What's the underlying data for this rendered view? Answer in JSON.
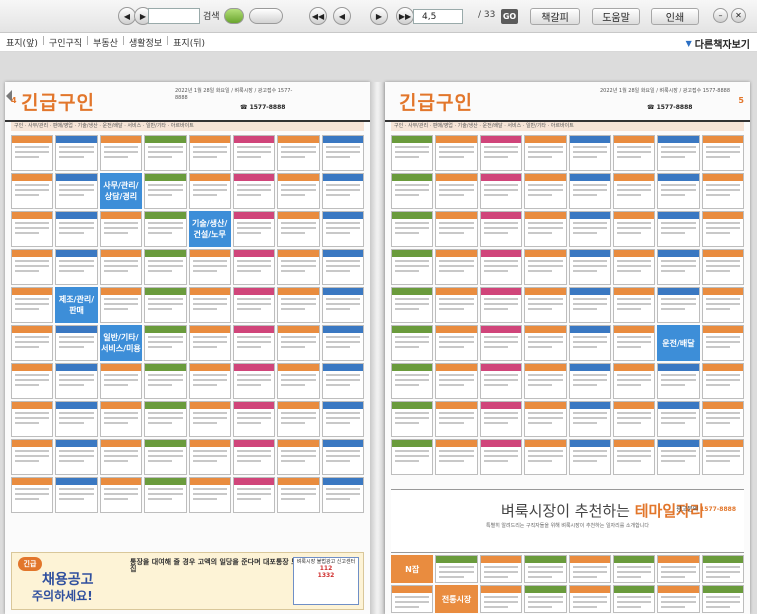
{
  "toolbar": {
    "search_label": "검색",
    "page_current": "4,5",
    "page_total": "/ 33",
    "go_label": "GO",
    "view_label": "책갈피",
    "help_label": "도움말",
    "print_label": "인쇄",
    "nav_first": "◀◀",
    "nav_prev": "◀",
    "nav_next": "▶",
    "nav_last": "▶▶"
  },
  "breadcrumb": {
    "items": [
      "표지(앞)",
      "구인구직",
      "부동산",
      "생활정보",
      "표지(뒤)"
    ]
  },
  "more_button": {
    "label": "다른책자보기"
  },
  "left_page": {
    "number": "4",
    "title": "긴급구인",
    "info": "2022년 1월 28일 화요일 / 벼룩시장 / 광고접수 1577-8888",
    "phone": "☎ 1577-8888",
    "category_bar": "구인 · 사무/관리 · 판매/영업 · 기술/생산 · 운전/배달 · 서비스 · 일반/기타 · 아르바이트",
    "feature_tiles": [
      "사무/관리/상담/경리",
      "기술/생산/건설/노무",
      "제조/관리/판매",
      "일반/기타/서비스/미용"
    ],
    "banner": {
      "badge": "긴급",
      "title": "채용공고",
      "subtitle": "주의하세요!",
      "headline": "통장을 대여해 줄 경우 고액의 일당을 준다며 대포통장 모집",
      "box_label": "벼룩시장 불법광고 신고센터",
      "box_number_1": "112",
      "box_number_2": "1332"
    }
  },
  "right_page": {
    "number": "5",
    "title": "긴급구인",
    "info": "2022년 1월 28일 화요일 / 벼룩시장 / 광고접수 1577-8888",
    "phone": "☎ 1577-8888",
    "category_bar": "구인 · 사무/관리 · 판매/영업 · 기술/생산 · 운전/배달 · 서비스 · 일반/기타 · 아르바이트",
    "feature_tiles": [
      "운전/배달",
      "N잡",
      "전통시장"
    ],
    "banner": {
      "title_plain": "벼룩시장이 추천하는 ",
      "title_accent": "테마일자리",
      "subtitle": "특별히 알려드리는 구직자들을 위해 벼룩시장이 추천하는 일자리를 소개합니다",
      "phone_label": "광고문의",
      "phone": "1577-8888"
    }
  },
  "icons": {
    "back": "back-arrow-icon",
    "forward": "forward-arrow-icon",
    "window_min": "minimize-icon",
    "window_close": "close-icon"
  }
}
